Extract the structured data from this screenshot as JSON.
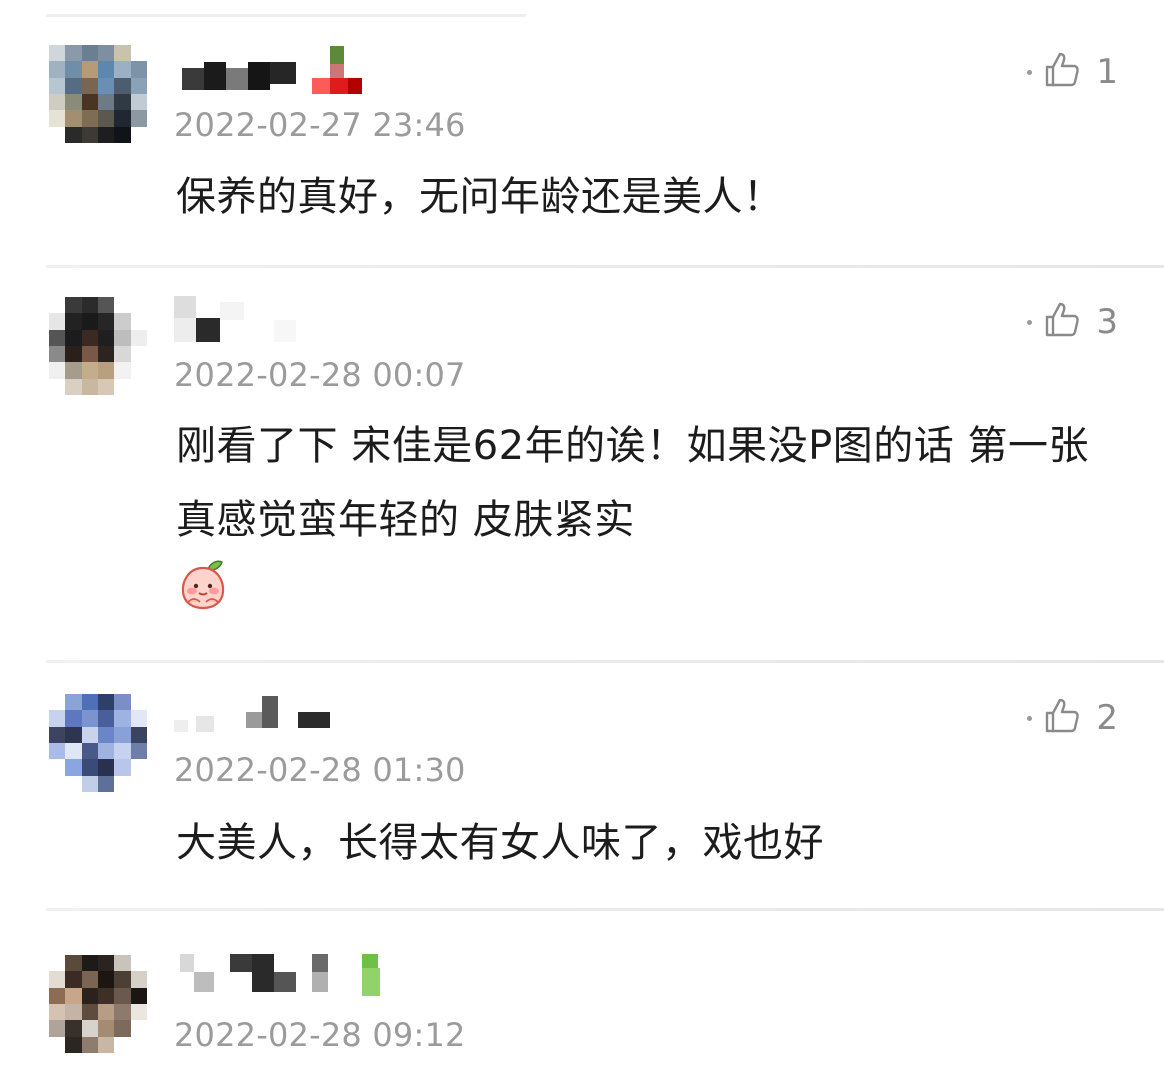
{
  "comments": [
    {
      "timestamp": "2022-02-27 23:46",
      "text": "保养的真好，无问年龄还是美人！",
      "likes": "1",
      "like_icon": "thumbs-up-icon"
    },
    {
      "timestamp": "2022-02-28 00:07",
      "text": "刚看了下 宋佳是62年的诶！如果没P图的话 第一张真感觉蛮年轻的 皮肤紧实",
      "likes": "3",
      "like_icon": "thumbs-up-icon",
      "emoji": "peach-face-emoji"
    },
    {
      "timestamp": "2022-02-28 01:30",
      "text": "大美人，长得太有女人味了，戏也好",
      "likes": "2",
      "like_icon": "thumbs-up-icon"
    },
    {
      "timestamp": "2022-02-28 09:12",
      "text": "",
      "likes": "",
      "like_icon": ""
    }
  ],
  "colors": {
    "timestamp": "#9b9b9b",
    "text": "#1c1c1c",
    "like": "#8a8a8a",
    "divider": "#e8e8e8"
  }
}
